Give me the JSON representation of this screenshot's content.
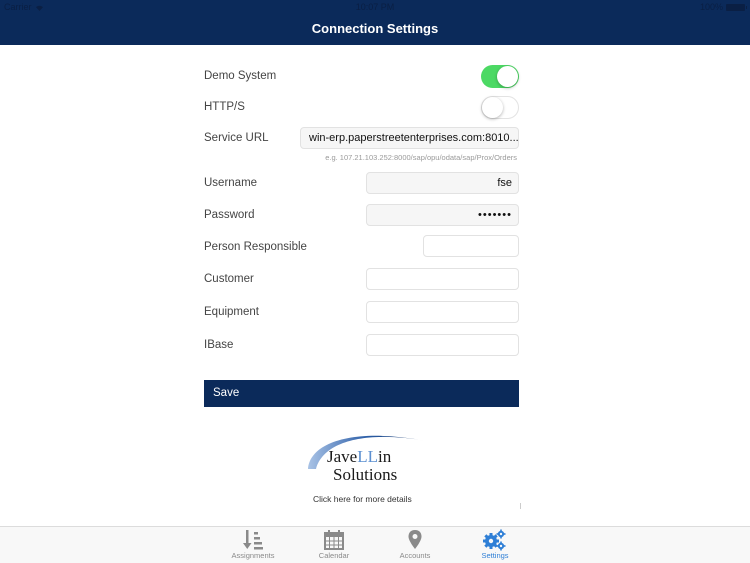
{
  "status_bar": {
    "carrier": "Carrier",
    "time": "10:07 PM",
    "battery": "100%"
  },
  "header": {
    "title": "Connection Settings"
  },
  "form": {
    "demo_system": {
      "label": "Demo System",
      "value": true
    },
    "https": {
      "label": "HTTP/S",
      "value": false
    },
    "service_url": {
      "label": "Service URL",
      "value": "win-erp.paperstreetenterprises.com:8010...",
      "hint": "e.g. 107.21.103.252:8000/sap/opu/odata/sap/Prox/Orders"
    },
    "username": {
      "label": "Username",
      "value": "fse"
    },
    "password": {
      "label": "Password",
      "value": "•••••••"
    },
    "person_responsible": {
      "label": "Person Responsible",
      "value": ""
    },
    "customer": {
      "label": "Customer",
      "value": ""
    },
    "equipment": {
      "label": "Equipment",
      "value": ""
    },
    "ibase": {
      "label": "IBase",
      "value": ""
    }
  },
  "save_label": "Save",
  "logo": {
    "line1_a": "Jave",
    "line1_b": "LL",
    "line1_c": "in",
    "line2": "Solutions"
  },
  "more_details": "Click here for more details",
  "tabs": [
    {
      "label": "Assignments",
      "icon": "assignments-sort-icon",
      "active": false
    },
    {
      "label": "Calendar",
      "icon": "calendar-icon",
      "active": false
    },
    {
      "label": "Accounts",
      "icon": "map-pin-icon",
      "active": false
    },
    {
      "label": "Settings",
      "icon": "gears-icon",
      "active": true
    }
  ],
  "colors": {
    "brand": "#0b2a5a",
    "toggle_on": "#4cd964",
    "tab_active": "#2f7fd6"
  }
}
